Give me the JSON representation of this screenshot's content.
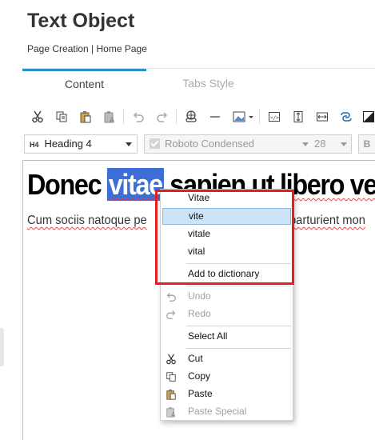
{
  "header": {
    "title": "Text Object",
    "breadcrumb": "Page Creation | Home Page"
  },
  "tabs": [
    {
      "label": "Content",
      "active": true
    },
    {
      "label": "Tabs Style",
      "active": false
    }
  ],
  "toolbar": {
    "icons": [
      "cut-icon",
      "copy-icon",
      "paste-icon",
      "paste-special-icon",
      "undo-icon",
      "redo-icon",
      "link-icon",
      "horizontal-rule-icon",
      "image-icon",
      "source-code-icon",
      "vertical-align-icon",
      "horizontal-fit-icon",
      "unlink-icon",
      "fill-color-icon"
    ]
  },
  "format": {
    "heading_tag": "H4",
    "heading_label": "Heading 4",
    "font_family": "Roboto Condensed",
    "font_size": "28",
    "bold_label": "B"
  },
  "editor": {
    "heading_before": "Donec ",
    "heading_selected": "vitae",
    "heading_after": " sapien ut libero ve",
    "body_text": "Cum sociis natoque pe",
    "body_text_right": "parturient mon",
    "colors": {
      "selection": "#3d6ed6",
      "spell_error": "#e04040"
    }
  },
  "context_menu": {
    "suggestions": [
      "Vitae",
      "vite",
      "vitale",
      "vital"
    ],
    "add_to_dictionary": "Add to dictionary",
    "undo": "Undo",
    "redo": "Redo",
    "select_all": "Select All",
    "cut": "Cut",
    "copy": "Copy",
    "paste": "Paste",
    "paste_special": "Paste Special",
    "highlight_color": "#e41f1f"
  },
  "theme": {
    "accent": "#2a8fc7",
    "menu_hover": "#cde3f7"
  }
}
